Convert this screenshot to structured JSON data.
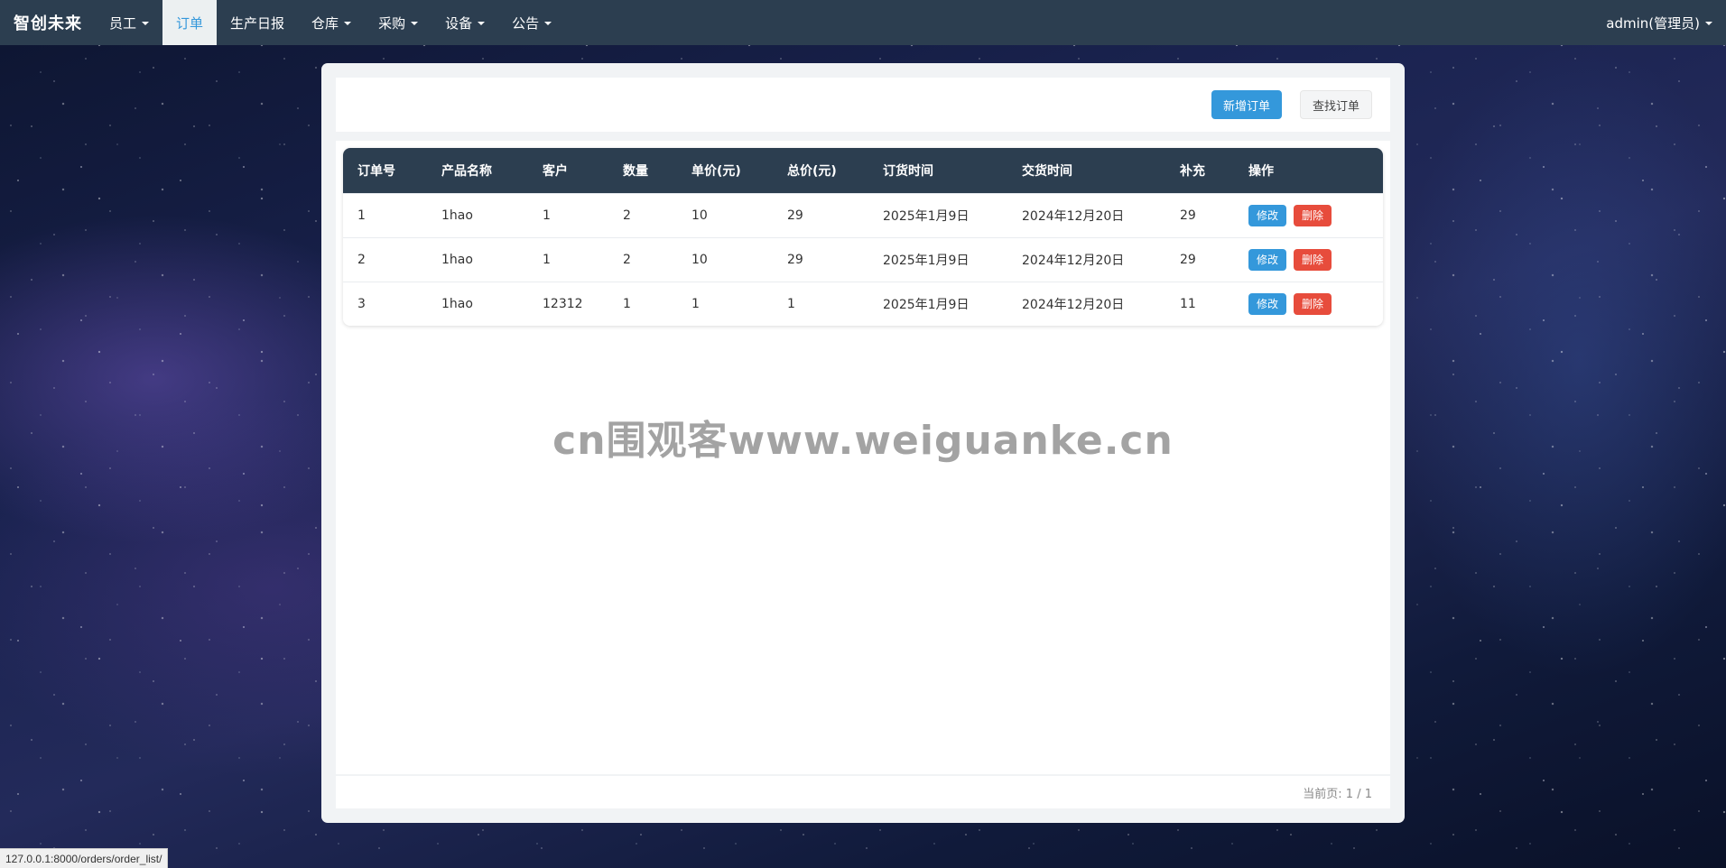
{
  "navbar": {
    "brand": "智创未来",
    "items": [
      {
        "label": "员工",
        "dropdown": true,
        "active": false
      },
      {
        "label": "订单",
        "dropdown": false,
        "active": true
      },
      {
        "label": "生产日报",
        "dropdown": false,
        "active": false
      },
      {
        "label": "仓库",
        "dropdown": true,
        "active": false
      },
      {
        "label": "采购",
        "dropdown": true,
        "active": false
      },
      {
        "label": "设备",
        "dropdown": true,
        "active": false
      },
      {
        "label": "公告",
        "dropdown": true,
        "active": false
      }
    ],
    "user": "admin(管理员)"
  },
  "toolbar": {
    "add_label": "新增订单",
    "search_label": "查找订单"
  },
  "table": {
    "headers": [
      "订单号",
      "产品名称",
      "客户",
      "数量",
      "单价(元)",
      "总价(元)",
      "订货时间",
      "交货时间",
      "补充",
      "操作"
    ],
    "rows": [
      [
        "1",
        "1hao",
        "1",
        "2",
        "10",
        "29",
        "2025年1月9日",
        "2024年12月20日",
        "29"
      ],
      [
        "2",
        "1hao",
        "1",
        "2",
        "10",
        "29",
        "2025年1月9日",
        "2024年12月20日",
        "29"
      ],
      [
        "3",
        "1hao",
        "12312",
        "1",
        "1",
        "1",
        "2025年1月9日",
        "2024年12月20日",
        "11"
      ]
    ],
    "edit_label": "修改",
    "delete_label": "删除"
  },
  "watermark": "cn围观客www.weiguanke.cn",
  "pagination": {
    "text": "当前页: 1 / 1"
  },
  "statusbar": {
    "url": "127.0.0.1:8000/orders/order_list/"
  },
  "colors": {
    "navbar": "#2c3e50",
    "primary": "#3498db",
    "danger": "#e74c3c",
    "panel": "#f1f3f5"
  }
}
